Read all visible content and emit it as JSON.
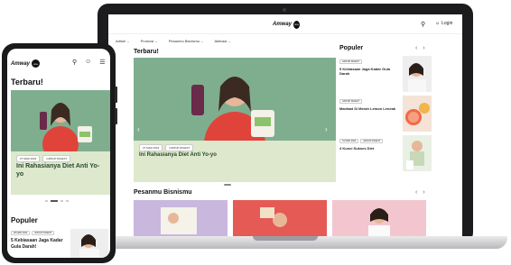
{
  "laptop": {
    "header": {
      "logo_text": "Amway",
      "logo_badge": "one",
      "login_label": "Login"
    },
    "nav": [
      "Artikel",
      "Promosi",
      "Pesanmu Bisnismu",
      "Aktivasi"
    ],
    "terbaru_title": "Terbaru!",
    "hero": {
      "badges": [
        "27 MAR 2024",
        "GROUP DIGEST"
      ],
      "title": "Ini Rahasianya Diet Anti Yo-yo"
    },
    "populer_title": "Populer",
    "populer_items": [
      {
        "badges": [
          "GROUP DIGEST"
        ],
        "title": "5 Kebiasaan Jaga Kadar Gula Darah"
      },
      {
        "badges": [
          "GROUP DIGEST"
        ],
        "title": "Manfaat Si Merah Lemon Leneak"
      },
      {
        "badges": [
          "31 MAR 2024",
          "GROUP DIGEST"
        ],
        "title": "4 Kunci Sukses Diet"
      }
    ],
    "bisnis_title": "Pesanmu Bisnismu"
  },
  "phone": {
    "header": {
      "logo_text": "Amway",
      "logo_badge": "one"
    },
    "terbaru_title": "Terbaru!",
    "hero": {
      "badges": [
        "27 MAR 2024",
        "GROUP DIGEST"
      ],
      "title": "Ini Rahasianya Diet Anti Yo-yo"
    },
    "populer_title": "Populer",
    "populer_item": {
      "badges": [
        "28 MAR 2024",
        "GROUP DIGEST"
      ],
      "title": "5 Kebiasaan Jaga Kadar Gula Darah!"
    }
  },
  "colors": {
    "hero_green": "#7fae8f",
    "caption_green": "#dde8cc",
    "shirt_red": "#e0433a"
  }
}
